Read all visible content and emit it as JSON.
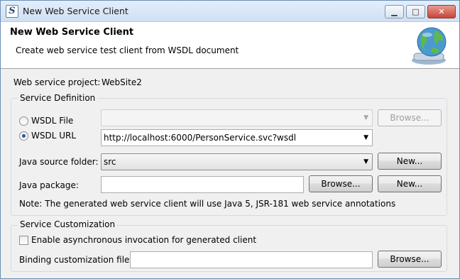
{
  "window": {
    "title": "New Web Service Client",
    "app_icon_glyph": "S",
    "controls": {
      "minimize": "▁",
      "maximize": "□",
      "close": "✕"
    }
  },
  "banner": {
    "title": "New Web Service Client",
    "subtitle": "Create web service test client from WSDL document",
    "icon": "globe-icon"
  },
  "project": {
    "label": "Web service project:",
    "value": "WebSite2"
  },
  "service_definition": {
    "legend": "Service Definition",
    "wsdl_file": {
      "label": "WSDL File",
      "checked": false,
      "value": "",
      "browse_label": "Browse...",
      "enabled": false
    },
    "wsdl_url": {
      "label": "WSDL URL",
      "checked": true,
      "value": "http://localhost:6000/PersonService.svc?wsdl"
    },
    "java_source_folder": {
      "label": "Java source folder:",
      "value": "src",
      "new_label": "New..."
    },
    "java_package": {
      "label": "Java package:",
      "value": "",
      "browse_label": "Browse...",
      "new_label": "New..."
    },
    "note": "Note: The generated web service client will use Java 5, JSR-181 web service annotations"
  },
  "service_customization": {
    "legend": "Service Customization",
    "async_checkbox": {
      "label": "Enable asynchronous invocation for generated client",
      "checked": false
    },
    "binding_file": {
      "label": "Binding customization file:",
      "value": "",
      "browse_label": "Browse..."
    }
  },
  "dropdown_arrow": "▼"
}
